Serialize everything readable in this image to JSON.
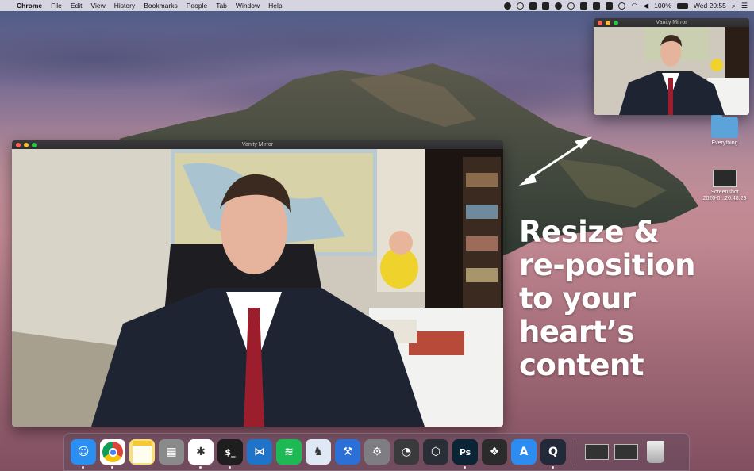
{
  "menubar": {
    "app_name": "Chrome",
    "items": [
      "File",
      "Edit",
      "View",
      "History",
      "Bookmarks",
      "People",
      "Tab",
      "Window",
      "Help"
    ],
    "battery": "100%",
    "clock": "Wed 20:55"
  },
  "windows": {
    "main_title": "Vanity Mirror",
    "mini_title": "Vanity Mirror"
  },
  "headline": {
    "line1": "Resize &",
    "line2": "re-position",
    "line3": "to your heart’s",
    "line4": "content"
  },
  "desktop_icons": [
    {
      "label": "Everything",
      "icon": "folder-icon"
    },
    {
      "label1": "Screenshot",
      "label2": "2020-0...20.48.29",
      "icon": "screenshot-thumb-icon"
    }
  ],
  "dock": {
    "apps": [
      {
        "name": "finder",
        "icon": "finder-icon",
        "color": "#2a8ff0",
        "glyph": "☺",
        "running": true
      },
      {
        "name": "chrome",
        "icon": "chrome-icon",
        "color": "#ffffff",
        "glyph": "",
        "running": true
      },
      {
        "name": "notes",
        "icon": "notes-icon",
        "color": "#f7e07a",
        "glyph": "",
        "running": false
      },
      {
        "name": "calculator",
        "icon": "calculator-icon",
        "color": "#8a8a8a",
        "glyph": "▦",
        "running": false
      },
      {
        "name": "slack",
        "icon": "slack-icon",
        "color": "#ffffff",
        "glyph": "✱",
        "running": true
      },
      {
        "name": "terminal",
        "icon": "terminal-icon",
        "color": "#1e1e1e",
        "glyph": "$_",
        "running": true
      },
      {
        "name": "vscode",
        "icon": "vscode-icon",
        "color": "#1f73c8",
        "glyph": "⋈",
        "running": false
      },
      {
        "name": "spotify",
        "icon": "spotify-icon",
        "color": "#1db954",
        "glyph": "≋",
        "running": false
      },
      {
        "name": "transmit",
        "icon": "chess-knight-icon",
        "color": "#dfe9f5",
        "glyph": "♞",
        "running": false
      },
      {
        "name": "xcode",
        "icon": "xcode-icon",
        "color": "#2c6fd6",
        "glyph": "⚒",
        "running": false
      },
      {
        "name": "system-preferences",
        "icon": "gear-icon",
        "color": "#7d7d82",
        "glyph": "⚙",
        "running": false
      },
      {
        "name": "instruments",
        "icon": "gauge-icon",
        "color": "#3a3a3c",
        "glyph": "◔",
        "running": false
      },
      {
        "name": "sketch-tool",
        "icon": "hexagon-icon",
        "color": "#2a2f37",
        "glyph": "⬡",
        "running": false
      },
      {
        "name": "photoshop",
        "icon": "photoshop-icon",
        "color": "#0b2436",
        "glyph": "Ps",
        "running": true
      },
      {
        "name": "figma",
        "icon": "figma-icon",
        "color": "#2b2b2b",
        "glyph": "❖",
        "running": false
      },
      {
        "name": "app-store",
        "icon": "app-store-icon",
        "color": "#2d8cf0",
        "glyph": "A",
        "running": false
      },
      {
        "name": "quicktime",
        "icon": "quicktime-icon",
        "color": "#222a3a",
        "glyph": "Q",
        "running": true
      }
    ],
    "recents": [
      {
        "name": "vanity-mirror",
        "icon": "video-thumb-icon"
      },
      {
        "name": "screen-thumb",
        "icon": "screen-thumb-icon"
      },
      {
        "name": "trash",
        "icon": "trash-icon"
      }
    ]
  }
}
